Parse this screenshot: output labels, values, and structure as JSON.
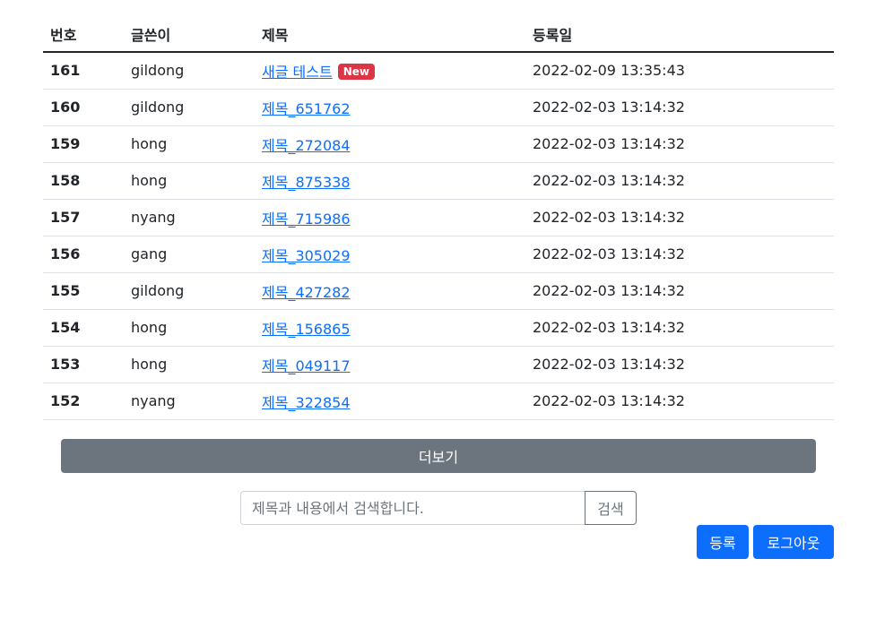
{
  "table": {
    "headers": {
      "num": "번호",
      "writer": "글쓴이",
      "title": "제목",
      "date": "등록일"
    },
    "rows": [
      {
        "num": "161",
        "writer": "gildong",
        "title": "새글 테스트",
        "badge": "New",
        "date": "2022-02-09 13:35:43"
      },
      {
        "num": "160",
        "writer": "gildong",
        "title": "제목_651762",
        "badge": "",
        "date": "2022-02-03 13:14:32"
      },
      {
        "num": "159",
        "writer": "hong",
        "title": "제목_272084",
        "badge": "",
        "date": "2022-02-03 13:14:32"
      },
      {
        "num": "158",
        "writer": "hong",
        "title": "제목_875338",
        "badge": "",
        "date": "2022-02-03 13:14:32"
      },
      {
        "num": "157",
        "writer": "nyang",
        "title": "제목_715986",
        "badge": "",
        "date": "2022-02-03 13:14:32"
      },
      {
        "num": "156",
        "writer": "gang",
        "title": "제목_305029",
        "badge": "",
        "date": "2022-02-03 13:14:32"
      },
      {
        "num": "155",
        "writer": "gildong",
        "title": "제목_427282",
        "badge": "",
        "date": "2022-02-03 13:14:32"
      },
      {
        "num": "154",
        "writer": "hong",
        "title": "제목_156865",
        "badge": "",
        "date": "2022-02-03 13:14:32"
      },
      {
        "num": "153",
        "writer": "hong",
        "title": "제목_049117",
        "badge": "",
        "date": "2022-02-03 13:14:32"
      },
      {
        "num": "152",
        "writer": "nyang",
        "title": "제목_322854",
        "badge": "",
        "date": "2022-02-03 13:14:32"
      }
    ]
  },
  "more_button": "더보기",
  "search": {
    "placeholder": "제목과 내용에서 검색합니다.",
    "value": "",
    "button": "검색"
  },
  "actions": {
    "register": "등록",
    "logout": "로그아웃"
  },
  "colors": {
    "primary": "#0d6efd",
    "secondary": "#6c757d",
    "danger": "#dc3545"
  }
}
